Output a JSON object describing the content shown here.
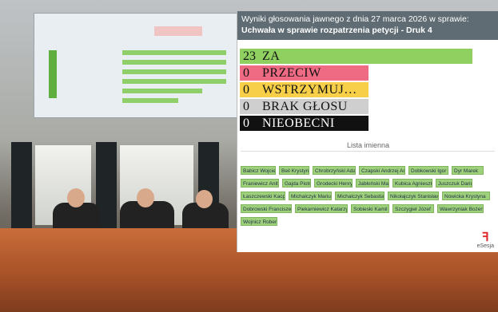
{
  "overlay": {
    "header_prefix": "Wyniki głosowania jawnego z dnia 27 marca 2026 w sprawie: ",
    "header_subject": "Uchwała w sprawie rozpatrzenia petycji - Druk 4",
    "results": [
      {
        "count": "23",
        "label": "ZA",
        "color": "#8fd061"
      },
      {
        "count": "0",
        "label": "PRZECIW",
        "color": "#ef6b84"
      },
      {
        "count": "0",
        "label": "WSTRZYMUJ…",
        "color": "#f7cf48"
      },
      {
        "count": "0",
        "label": "BRAK GŁOSU",
        "color": "#cfcfcf"
      },
      {
        "count": "0",
        "label": "NIEOBECNI",
        "color": "#111111",
        "text_color": "#ffffff"
      }
    ],
    "list_title": "Lista imienna",
    "names": [
      "Babicz Wojciech",
      "Beil Krystyna",
      "Chrobrzyński Adam",
      "Czapski Andrzej Antoni",
      "Dobkowski Igor",
      "Dyr Marek",
      "Franiewicz Anita",
      "Gajda Piotr",
      "Grodecki Henryk",
      "Jabłoński Marcin",
      "Kubica Agnieszka",
      "Juszczuk Dariusz",
      "Łaszczewski Kacper",
      "Michalczyk Mariusz",
      "Michalczyk Sebastian",
      "Nikołajczyk Stanisław",
      "Nowicka Krystyna",
      "Dobrowski Franciszek",
      "Piekarniewicz Katarzyna",
      "Sobieski Kamil",
      "Szczygieł Józef",
      "Wawrzyniak Bożena",
      "Wojnicz Robert"
    ],
    "brand": "eSesja",
    "brand_icon": "esesja-logo-icon"
  }
}
